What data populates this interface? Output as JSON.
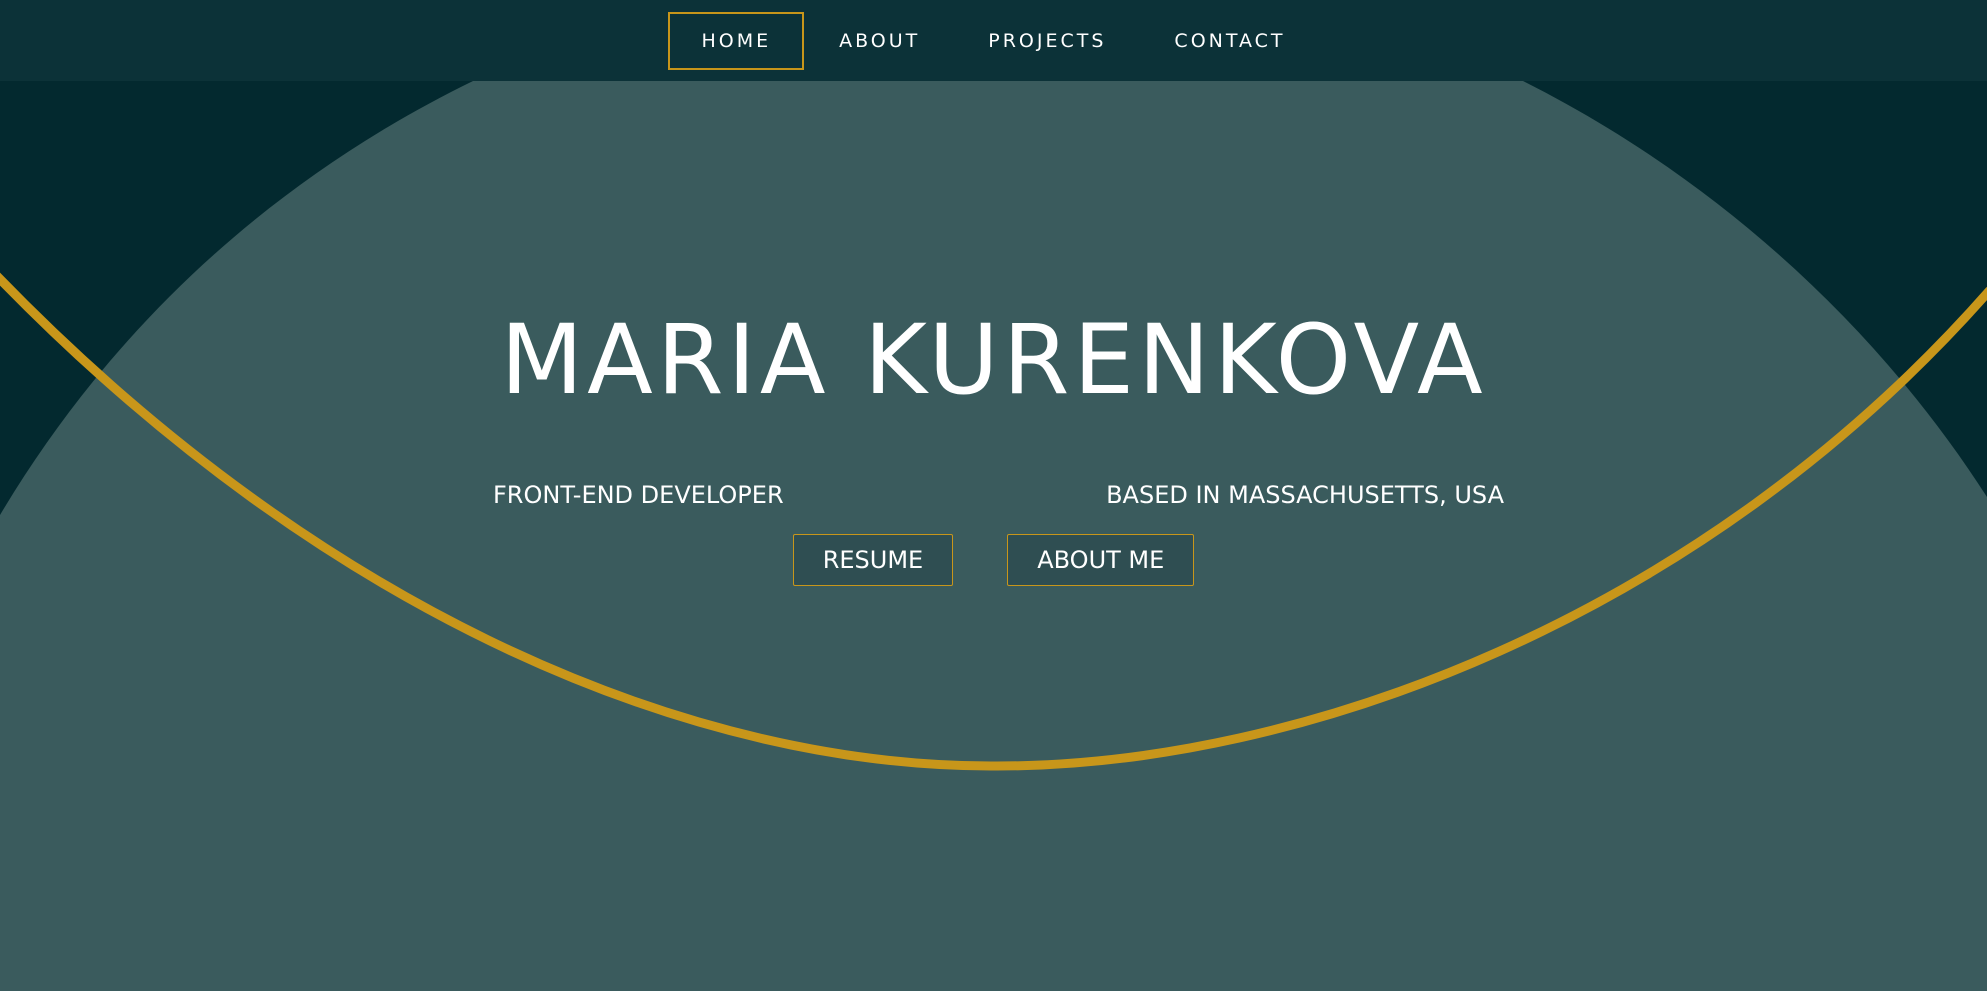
{
  "nav": {
    "items": [
      {
        "label": "HOME",
        "active": true
      },
      {
        "label": "ABOUT",
        "active": false
      },
      {
        "label": "PROJECTS",
        "active": false
      },
      {
        "label": "CONTACT",
        "active": false
      }
    ]
  },
  "hero": {
    "name": "MARIA KURENKOVA",
    "role": "FRONT-END DEVELOPER",
    "location": "BASED IN MASSACHUSETTS, USA",
    "buttons": {
      "resume": "RESUME",
      "about_me": "ABOUT ME"
    }
  },
  "colors": {
    "nav_background": "#0c3238",
    "dark_corner": "#03292f",
    "hero_background": "#3a5b5d",
    "accent_gold": "#c8961a",
    "text": "#ffffff",
    "button_background": "#2f4e52"
  }
}
